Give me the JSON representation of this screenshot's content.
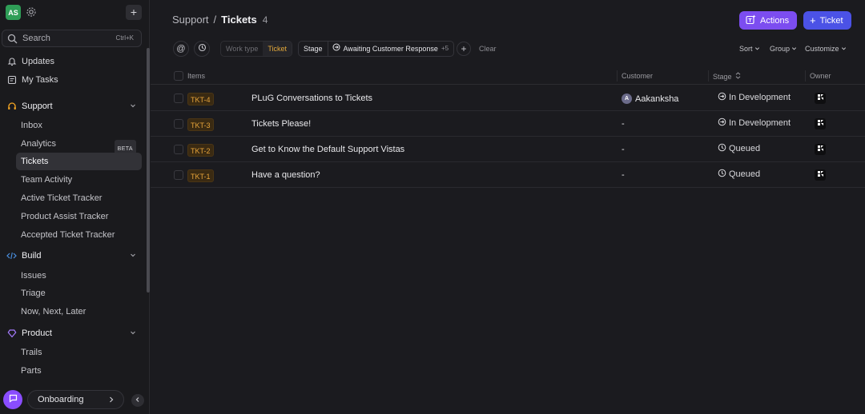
{
  "sidebar": {
    "avatar_initials": "AS",
    "search": {
      "label": "Search",
      "shortcut": "Ctrl+K"
    },
    "top_items": [
      {
        "label": "Updates",
        "icon": "bell-icon"
      },
      {
        "label": "My Tasks",
        "icon": "tasks-icon"
      }
    ],
    "sections": [
      {
        "label": "Support",
        "icon": "headset-icon",
        "accent": "#f5a623",
        "items": [
          "Inbox",
          "Analytics",
          "Tickets",
          "Team Activity",
          "Active Ticket Tracker",
          "Product Assist Tracker",
          "Accepted Ticket Tracker"
        ]
      },
      {
        "label": "Build",
        "icon": "code-icon",
        "accent": "#4a90e2",
        "items": [
          "Issues",
          "Triage",
          "Now, Next, Later"
        ]
      },
      {
        "label": "Product",
        "icon": "diamond-icon",
        "accent": "#a67cff",
        "items": [
          "Trails",
          "Parts"
        ]
      }
    ],
    "beta_badge": "BETA",
    "active_item": "Tickets",
    "onboarding_label": "Onboarding"
  },
  "header": {
    "breadcrumb_parent": "Support",
    "separator": "/",
    "breadcrumb_current": "Tickets",
    "count": "4",
    "actions_label": "Actions",
    "ticket_label": "Ticket",
    "actions_color": "#7c4df0",
    "ticket_color": "#4b52e6"
  },
  "filters": {
    "worktype_key": "Work type",
    "worktype_value": "Ticket",
    "stage_key": "Stage",
    "stage_value": "Awaiting Customer Response",
    "stage_more": "+5",
    "clear_label": "Clear",
    "sort_label": "Sort",
    "group_label": "Group",
    "customize_label": "Customize"
  },
  "table": {
    "columns": [
      "Items",
      "Customer",
      "Stage",
      "Owner"
    ],
    "rows": [
      {
        "id": "TKT-4",
        "title": "PLuG Conversations to Tickets",
        "customer": "Aakanksha",
        "customer_initial": "A",
        "stage": "In Development",
        "stage_icon": "arrow-circle-icon"
      },
      {
        "id": "TKT-3",
        "title": "Tickets Please!",
        "customer": "-",
        "stage": "In Development",
        "stage_icon": "arrow-circle-icon"
      },
      {
        "id": "TKT-2",
        "title": "Get to Know the Default Support Vistas",
        "customer": "-",
        "stage": "Queued",
        "stage_icon": "clock-icon"
      },
      {
        "id": "TKT-1",
        "title": "Have a question?",
        "customer": "-",
        "stage": "Queued",
        "stage_icon": "clock-icon"
      }
    ]
  }
}
